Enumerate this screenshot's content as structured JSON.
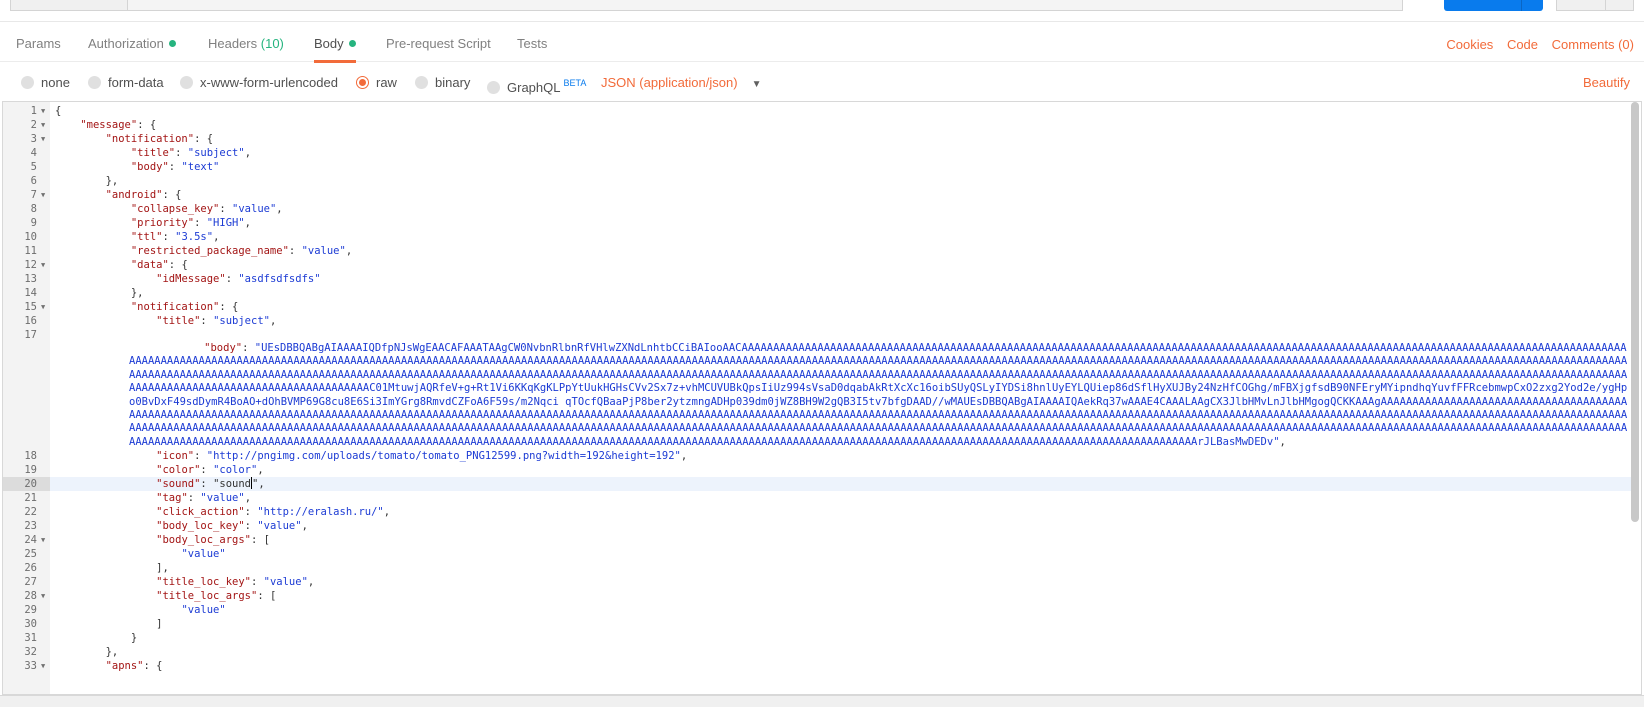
{
  "tabs": [
    {
      "label": "Params"
    },
    {
      "label": "Authorization",
      "dot": true
    },
    {
      "label": "Headers",
      "count": "(10)"
    },
    {
      "label": "Body",
      "dot": true,
      "active": true
    },
    {
      "label": "Pre-request Script"
    },
    {
      "label": "Tests"
    }
  ],
  "tab_links": {
    "cookies": "Cookies",
    "code": "Code",
    "comments": "Comments (0)"
  },
  "body_options": {
    "none": "none",
    "form_data": "form-data",
    "urlencoded": "x-www-form-urlencoded",
    "raw": "raw",
    "binary": "binary",
    "graphql": "GraphQL",
    "graphql_badge": "BETA",
    "selected": "raw",
    "content_type": "JSON (application/json)",
    "beautify": "Beautify"
  },
  "colors": {
    "accent": "#f26b3a",
    "green_dot": "#26b47f",
    "send_blue": "#097bed"
  },
  "editor": {
    "current_line": 20,
    "lines": [
      {
        "n": "1",
        "text": "{",
        "fold": true
      },
      {
        "n": "2",
        "text": "    \"message\": {",
        "fold": true
      },
      {
        "n": "3",
        "text": "        \"notification\": {",
        "fold": true
      },
      {
        "n": "4",
        "text": "            \"title\": \"subject\","
      },
      {
        "n": "5",
        "text": "            \"body\": \"text\""
      },
      {
        "n": "6",
        "text": "        },"
      },
      {
        "n": "7",
        "text": "        \"android\": {",
        "fold": true
      },
      {
        "n": "8",
        "text": "            \"collapse_key\": \"value\","
      },
      {
        "n": "9",
        "text": "            \"priority\": \"HIGH\","
      },
      {
        "n": "10",
        "text": "            \"ttl\": \"3.5s\","
      },
      {
        "n": "11",
        "text": "            \"restricted_package_name\": \"value\","
      },
      {
        "n": "12",
        "text": "            \"data\": {",
        "fold": true
      },
      {
        "n": "13",
        "text": "                \"idMessage\": \"asdfsdfsdfs\""
      },
      {
        "n": "14",
        "text": "            },"
      },
      {
        "n": "15",
        "text": "            \"notification\": {",
        "fold": true
      },
      {
        "n": "16",
        "text": "                \"title\": \"subject\","
      },
      {
        "n": "17",
        "text": "                \"body\": ",
        "long": "\"UEsDBBQABgAIAAAAIQDfpNJsWgEAACAFAAATAAgCW0NvbnRlbnRfVHlwZXNdLnhtbCCiBAIooAACAAAAAAAAAAAAAAAAAAAAAAAAAAAAAAAAAAAAAAAAAAAAAAAAAAAAAAAAAAAAAAAAAAAAAAAAAAAAAAAAAAAAAAAAAAAAAAAAAAAAAAAAAAAAAAAAAAAAAAAAAAAAAAAAAAAAAAAAAAAAAAAAAAAAAAAAAAAAAAAAAAAAAAAAAAAAAAAAAAAAAAAAAAAAAAAAAAAAAAAAAAAAAAAAAAAAAAAAAAAAAAAAAAAAAAAAAAAAAAAAAAAAAAAAAAAAAAAAAAAAAAAAAAAAAAAAAAAAAAAAAAAAAAAAAAAAAAAAAAAAAAAAAAAAAAAAAAAAAAAAAAAAAAAAAAAAAAAAAAAAAAAAAAAAAAAAAAAAAAAAAAAAAAAAAAAAAAAAAAAAAAAAAAAAAAAAAAAAAAAAAAAAAAAAAAAAAAAAAAAAAAAAAAAAAAAAAAAAAAAAAAAAAAAAAAAAAAAAAAAAAAAAAAAAAAAAAAAAAAAAAAAAAAAAAAAAAAAAAAAAAAAAAAAAAAAAAAAAAAAAAAAAAAAAAAAAAAAAAAAAAAAAAAAAAAAAAAAAAAAAAAAAAAAAAAAAAAAAAAAAAAAAAAAAAAAAAAAAAAAAAAAAAAAAAAAAAAAAAAAAAAAAAAAAAAAAAAAAAAAAAAAAAAAAAAAAC01MtuwjAQRfeV+g+Rt1Vi6KKqKgKLPpYtUukHGHsCVv2Sx7z+vhMCUVUBkQpsIiUz994sVsaD0dqabAkRtXcXc16oibSUyQSLyIYDSi8hnlUyEYLQUiep86dSflHyXUJBy24NzHfCOGhg/mFBXjgfsdB90NFEryMYipndhqYuvfFFRcebmwpCxO2zxg2Yod2e/ygHpo0BvDxF49sdDymR4BoAO+dOhBVMP69G8cu8E6Si3ImYGrg8RmvdCZFoA6F59s/m2Nqci qTOcfQBaaPjP8ber2ytzmngADHp039dm0jWZ8BH9W2gQB3I5tv7bfgDAAD//wMAUEsDBBQABgAIAAAAIQAekRq37wAAAE4CAAALAAgCX3JlbHMvLnJlbHMgogQCKKAAAgAAAAAAAAAAAAAAAAAAAAAAAAAAAAAAAAAAAAAAAAAAAAAAAAAAAAAAAAAAAAAAAAAAAAAAAAAAAAAAAAAAAAAAAAAAAAAAAAAAAAAAAAAAAAAAAAAAAAAAAAAAAAAAAAAAAAAAAAAAAAAAAAAAAAAAAAAAAAAAAAAAAAAAAAAAAAAAAAAAAAAAAAAAAAAAAAAAAAAAAAAAAAAAAAAAAAAAAAAAAAAAAAAAAAAAAAAAAAAAAAAAAAAAAAAAAAAAAAAAAAAAAAAAAAAAAAAAAAAAAAAAAAAAAAAAAAAAAAAAAAAAAAAAAAAAAAAAAAAAAAAAAAAAAAAAAAAAAAAAAAAAAAAAAAAAAAAAAAAAAAAAAAAAAAAAAAAAAAAAAAAAAAAAAAAAAAAAAAAAAAAAAAAAAAAAAAAAAAAAAAAAAAAAAAAAAAAAAAAAAAAAAAAAAAAAAAAAAAAAAAAAAAAAAAAAAAAAAAAAAAAAAAAAAAAAAAAAAAAAAAAAAAAAAAAAAAAAAAAAAAAAAAAAAAAAAAAAAAAAAAAAAAAAAAAAAAAAAAAAAAAAAAAAAAAAAAAAAAAAAAAAAAAAAAAAAAAAAAAAAAAAAAAAAAAAAAAAAAAAAAAAAAAAAAAAAAAAAAAAAAAAAAAAAAAAAAAAAAAAAAAAAAAAAAAAAAAAAAAAAAAArJLBasMwDEDv\"",
        "long_suffix": ","
      },
      {
        "n": "18",
        "text": "                \"icon\": \"http://pngimg.com/uploads/tomato/tomato_PNG12599.png?width=192&height=192\","
      },
      {
        "n": "19",
        "text": "                \"color\": \"color\","
      },
      {
        "n": "20",
        "text": "                \"sound\": \"sound\","
      },
      {
        "n": "21",
        "text": "                \"tag\": \"value\","
      },
      {
        "n": "22",
        "text": "                \"click_action\": \"http://eralash.ru/\","
      },
      {
        "n": "23",
        "text": "                \"body_loc_key\": \"value\","
      },
      {
        "n": "24",
        "text": "                \"body_loc_args\": [",
        "fold": true
      },
      {
        "n": "25",
        "text": "                    \"value\""
      },
      {
        "n": "26",
        "text": "                ],"
      },
      {
        "n": "27",
        "text": "                \"title_loc_key\": \"value\","
      },
      {
        "n": "28",
        "text": "                \"title_loc_args\": [",
        "fold": true
      },
      {
        "n": "29",
        "text": "                    \"value\""
      },
      {
        "n": "30",
        "text": "                ]"
      },
      {
        "n": "31",
        "text": "            }"
      },
      {
        "n": "32",
        "text": "        },"
      },
      {
        "n": "33",
        "text": "        \"apns\": {",
        "fold": true
      }
    ]
  }
}
